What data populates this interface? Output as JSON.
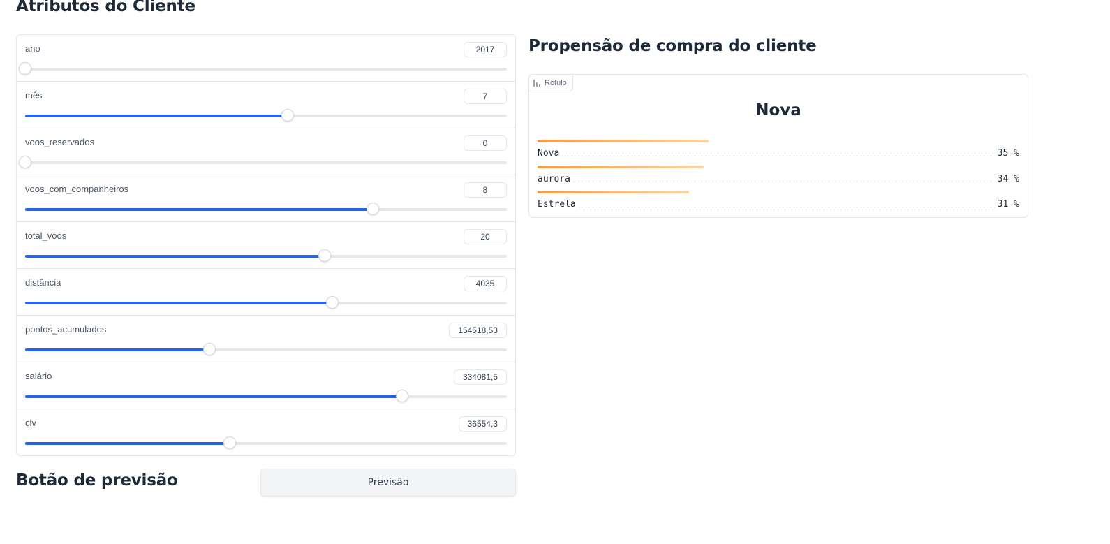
{
  "inputs_section": {
    "title": "Atributos do Cliente",
    "sliders": [
      {
        "label": "ano",
        "value": "2017",
        "fraction": 0.0
      },
      {
        "label": "mês",
        "value": "7",
        "fraction": 0.545
      },
      {
        "label": "voos_reservados",
        "value": "0",
        "fraction": 0.0
      },
      {
        "label": "voos_com_companheiros",
        "value": "8",
        "fraction": 0.722
      },
      {
        "label": "total_voos",
        "value": "20",
        "fraction": 0.622
      },
      {
        "label": "distância",
        "value": "4035",
        "fraction": 0.638
      },
      {
        "label": "pontos_acumulados",
        "value": "154518,53",
        "fraction": 0.383
      },
      {
        "label": "salário",
        "value": "334081,5",
        "fraction": 0.783
      },
      {
        "label": "clv",
        "value": "36554,3",
        "fraction": 0.425
      }
    ]
  },
  "predict_section": {
    "title": "Botão de previsão",
    "button_label": "Previsão"
  },
  "output_section": {
    "title": "Propensão de compra do cliente",
    "chip_label": "Rótulo",
    "top_label": "Nova",
    "confidences": [
      {
        "label": "Nova",
        "percent": "35 %",
        "value": 0.35
      },
      {
        "label": "aurora",
        "percent": "34 %",
        "value": 0.34
      },
      {
        "label": "Estrela",
        "percent": "31 %",
        "value": 0.31
      }
    ]
  },
  "colors": {
    "slider_fill": "#2563eb",
    "slider_track": "#e5e7eb",
    "confidence_start": "#f59a45",
    "confidence_end": "#fdd5a0"
  }
}
